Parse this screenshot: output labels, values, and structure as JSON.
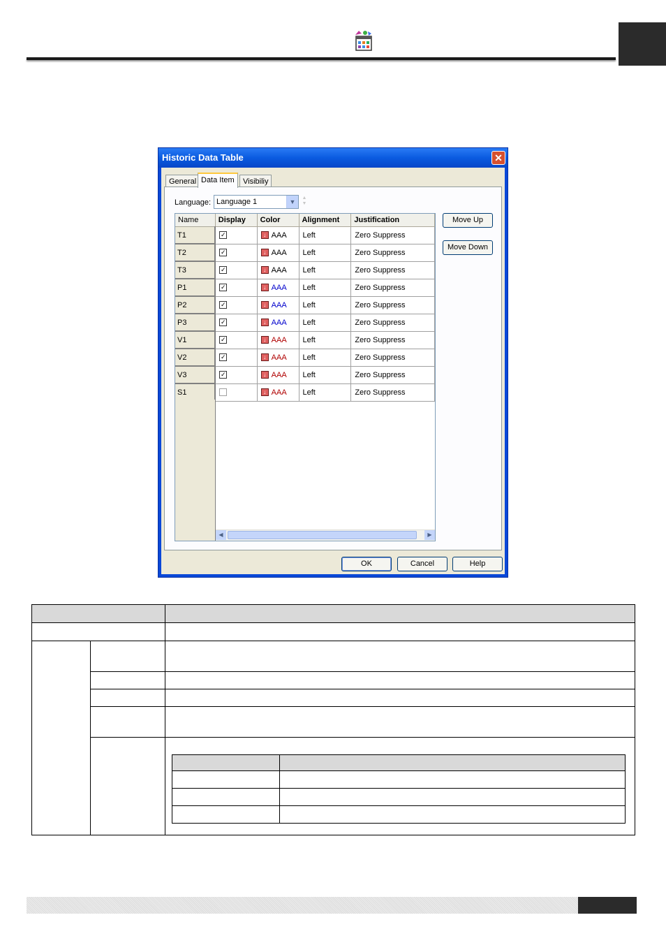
{
  "dialog": {
    "title": "Historic Data Table",
    "close_glyph": "✕",
    "tabs": [
      "General",
      "Data Item",
      "Visibiliy"
    ],
    "active_tab": "Data Item",
    "language_label": "Language:",
    "language_value": "Language 1",
    "columns": [
      "Name",
      "Display",
      "Color",
      "Alignment",
      "Justification"
    ],
    "rows": [
      {
        "name": "T1",
        "display": true,
        "color_text": "AAA",
        "text_color": "#000000",
        "alignment": "Left",
        "justification": "Zero Suppress"
      },
      {
        "name": "T2",
        "display": true,
        "color_text": "AAA",
        "text_color": "#000000",
        "alignment": "Left",
        "justification": "Zero Suppress"
      },
      {
        "name": "T3",
        "display": true,
        "color_text": "AAA",
        "text_color": "#000000",
        "alignment": "Left",
        "justification": "Zero Suppress"
      },
      {
        "name": "P1",
        "display": true,
        "color_text": "AAA",
        "text_color": "#0000cc",
        "alignment": "Left",
        "justification": "Zero Suppress"
      },
      {
        "name": "P2",
        "display": true,
        "color_text": "AAA",
        "text_color": "#0000cc",
        "alignment": "Left",
        "justification": "Zero Suppress"
      },
      {
        "name": "P3",
        "display": true,
        "color_text": "AAA",
        "text_color": "#0000cc",
        "alignment": "Left",
        "justification": "Zero Suppress"
      },
      {
        "name": "V1",
        "display": true,
        "color_text": "AAA",
        "text_color": "#b00000",
        "alignment": "Left",
        "justification": "Zero Suppress"
      },
      {
        "name": "V2",
        "display": true,
        "color_text": "AAA",
        "text_color": "#b00000",
        "alignment": "Left",
        "justification": "Zero Suppress"
      },
      {
        "name": "V3",
        "display": true,
        "color_text": "AAA",
        "text_color": "#b00000",
        "alignment": "Left",
        "justification": "Zero Suppress"
      },
      {
        "name": "S1",
        "display": false,
        "color_text": "AAA",
        "text_color": "#b00000",
        "alignment": "Left",
        "justification": "Zero Suppress"
      }
    ],
    "buttons": {
      "move_up": "Move Up",
      "move_down": "Move Down",
      "ok": "OK",
      "cancel": "Cancel",
      "help": "Help"
    }
  },
  "colors": {
    "title_bar": "#0a5be0",
    "dialog_face": "#ece9d8",
    "table_header": "#d9d9d9",
    "footer_dark": "#2b2b2b"
  }
}
